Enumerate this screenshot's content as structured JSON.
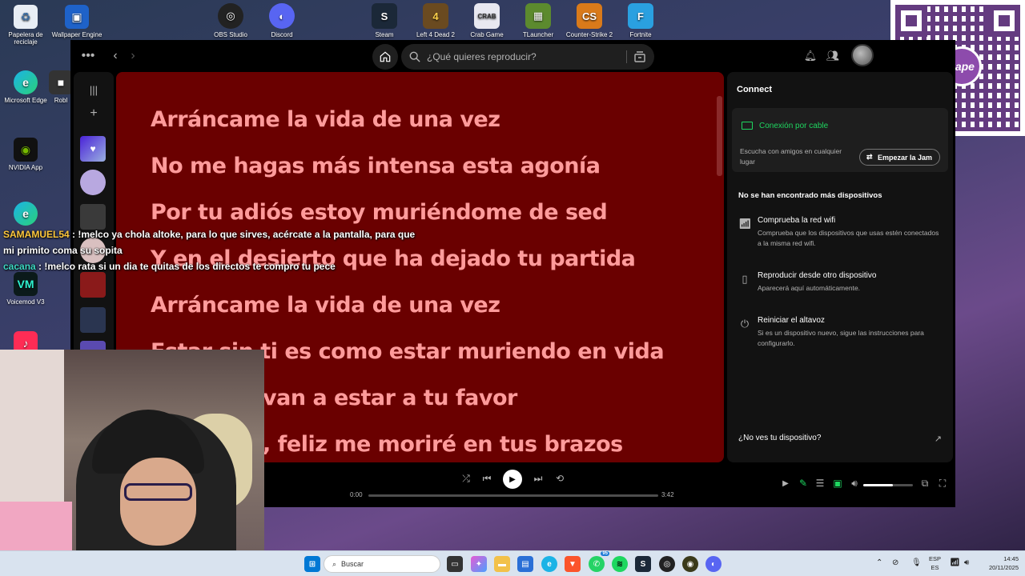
{
  "desktop": {
    "left_icons": [
      {
        "label": "Papelera de reciclaje",
        "icon": "recycle-bin-icon"
      },
      {
        "label": "Wallpaper Engine",
        "icon": "wallpaper-engine-icon"
      },
      {
        "label": "Microsoft Edge",
        "icon": "edge-icon"
      },
      {
        "label": "Robl",
        "icon": "roblox-icon"
      },
      {
        "label": "NVIDIA App",
        "icon": "nvidia-icon"
      },
      {
        "label": "Voicemod V3",
        "icon": "voicemod-icon"
      }
    ],
    "top_icons": [
      {
        "label": "OBS Studio",
        "icon": "obs-icon"
      },
      {
        "label": "Discord",
        "icon": "discord-icon"
      },
      {
        "label": "Steam",
        "icon": "steam-icon"
      },
      {
        "label": "Left 4 Dead 2",
        "icon": "l4d2-icon"
      },
      {
        "label": "Crab Game",
        "icon": "crab-game-icon"
      },
      {
        "label": "TLauncher",
        "icon": "tlauncher-icon"
      },
      {
        "label": "Counter-Strike 2",
        "icon": "cs2-icon"
      },
      {
        "label": "Fortnite",
        "icon": "fortnite-icon"
      }
    ]
  },
  "qr": {
    "brand": "yape"
  },
  "spotify": {
    "search_placeholder": "¿Qué quieres reproducir?",
    "lyrics": [
      "Arráncame la vida de una vez",
      "No me hagas más intensa esta agonía",
      "Por tu adiós estoy muriéndome de sed",
      "Y en el desierto que ha dejado tu partida",
      "Arráncame la vida de una vez",
      "Estar sin ti es como estar muriendo en vida",
      "van a estar a tu favor",
      ", feliz me moriré en tus brazos"
    ],
    "connect": {
      "title": "Connect",
      "cable_label": "Conexión por cable",
      "cable_desc": "Escucha con amigos en cualquier lugar",
      "jam_button": "Empezar la Jam",
      "no_devices": "No se han encontrado más dispositivos",
      "options": [
        {
          "title": "Comprueba la red wifi",
          "desc": "Comprueba que los dispositivos que usas estén conectados a la misma red wifi.",
          "icon": "wifi-icon"
        },
        {
          "title": "Reproducir desde otro dispositivo",
          "desc": "Aparecerá aquí automáticamente.",
          "icon": "devices-icon"
        },
        {
          "title": "Reiniciar el altavoz",
          "desc": "Si es un dispositivo nuevo, sigue las instrucciones para configurarlo.",
          "icon": "power-icon"
        }
      ],
      "see_device": "¿No ves tu dispositivo?"
    },
    "player": {
      "time_current": "0:00",
      "time_total": "3:42",
      "progress": 0,
      "volume": 0.6
    }
  },
  "chat": [
    {
      "user": "SAMAMUEL54",
      "message": ": !melco ya chola altoke, para lo que sirves, acércate a la pantalla, para que mi primito coma su sopita"
    },
    {
      "user": "cacana",
      "message": ": !melco rata si un dia te quitas de los directos te compro tu pece"
    }
  ],
  "taskbar": {
    "search_placeholder": "Buscar",
    "lang_top": "ESP",
    "lang_bottom": "ES",
    "time": "14:45",
    "date": "20/11/2025",
    "whatsapp_badge": "95"
  }
}
